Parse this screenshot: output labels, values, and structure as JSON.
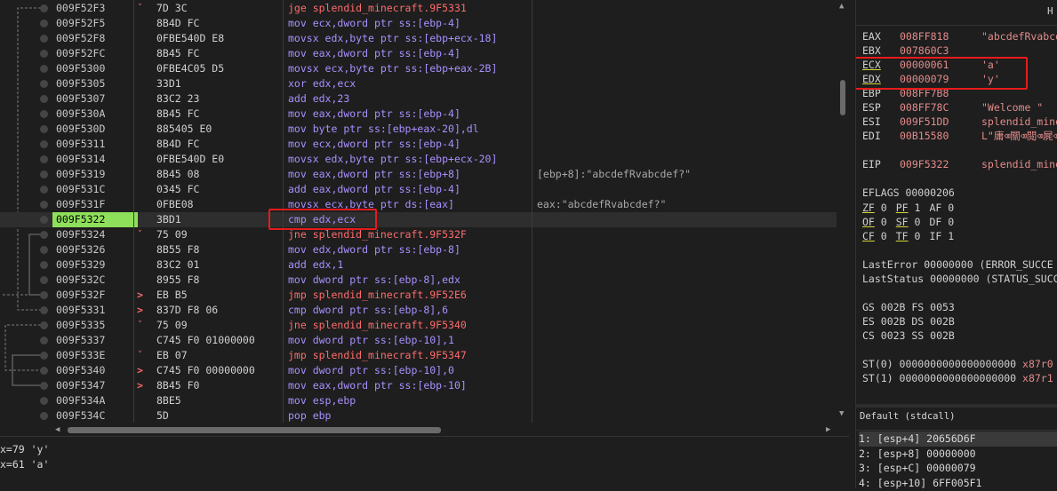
{
  "rows": [
    {
      "addr": "009F52F3",
      "mark": "ˇ",
      "bytes": "7D 3C",
      "op": "jge",
      "args": "splendid_minecraft.9F5331",
      "cls": "c-jmp",
      "cmt": ""
    },
    {
      "addr": "009F52F5",
      "mark": "",
      "bytes": "8B4D FC",
      "op": "mov",
      "args": "ecx,dword ptr ss:[ebp-4]",
      "cls": "c-mov",
      "cmt": ""
    },
    {
      "addr": "009F52F8",
      "mark": "",
      "bytes": "0FBE540D E8",
      "op": "movsx",
      "args": "edx,byte ptr ss:[ebp+ecx-18]",
      "cls": "c-mov",
      "cmt": ""
    },
    {
      "addr": "009F52FC",
      "mark": "",
      "bytes": "8B45 FC",
      "op": "mov",
      "args": "eax,dword ptr ss:[ebp-4]",
      "cls": "c-mov",
      "cmt": ""
    },
    {
      "addr": "009F5300",
      "mark": "",
      "bytes": "0FBE4C05 D5",
      "op": "movsx",
      "args": "ecx,byte ptr ss:[ebp+eax-2B]",
      "cls": "c-mov",
      "cmt": ""
    },
    {
      "addr": "009F5305",
      "mark": "",
      "bytes": "33D1",
      "op": "xor",
      "args": "edx,ecx",
      "cls": "c-xor",
      "cmt": ""
    },
    {
      "addr": "009F5307",
      "mark": "",
      "bytes": "83C2 23",
      "op": "add",
      "args": "edx,23",
      "cls": "c-arith",
      "cmt": ""
    },
    {
      "addr": "009F530A",
      "mark": "",
      "bytes": "8B45 FC",
      "op": "mov",
      "args": "eax,dword ptr ss:[ebp-4]",
      "cls": "c-mov",
      "cmt": ""
    },
    {
      "addr": "009F530D",
      "mark": "",
      "bytes": "885405 E0",
      "op": "mov",
      "args": "byte ptr ss:[ebp+eax-20],dl",
      "cls": "c-mov",
      "cmt": ""
    },
    {
      "addr": "009F5311",
      "mark": "",
      "bytes": "8B4D FC",
      "op": "mov",
      "args": "ecx,dword ptr ss:[ebp-4]",
      "cls": "c-mov",
      "cmt": ""
    },
    {
      "addr": "009F5314",
      "mark": "",
      "bytes": "0FBE540D E0",
      "op": "movsx",
      "args": "edx,byte ptr ss:[ebp+ecx-20]",
      "cls": "c-mov",
      "cmt": ""
    },
    {
      "addr": "009F5319",
      "mark": "",
      "bytes": "8B45 08",
      "op": "mov",
      "args": "eax,dword ptr ss:[ebp+8]",
      "cls": "c-mov",
      "cmt": "[ebp+8]:\"abcdefRvabcdef?\""
    },
    {
      "addr": "009F531C",
      "mark": "",
      "bytes": "0345 FC",
      "op": "add",
      "args": "eax,dword ptr ss:[ebp-4]",
      "cls": "c-arith",
      "cmt": ""
    },
    {
      "addr": "009F531F",
      "mark": "",
      "bytes": "0FBE08",
      "op": "movsx",
      "args": "ecx,byte ptr ds:[eax]",
      "cls": "c-mov",
      "cmt": "eax:\"abcdefRvabcdef?\""
    },
    {
      "addr": "009F5322",
      "mark": "",
      "bytes": "3BD1",
      "op": "cmp",
      "args": "edx,ecx",
      "cls": "c-cmp",
      "cmt": ""
    },
    {
      "addr": "009F5324",
      "mark": "ˇ",
      "bytes": "75 09",
      "op": "jne",
      "args": "splendid_minecraft.9F532F",
      "cls": "c-jcc",
      "cmt": ""
    },
    {
      "addr": "009F5326",
      "mark": "",
      "bytes": "8B55 F8",
      "op": "mov",
      "args": "edx,dword ptr ss:[ebp-8]",
      "cls": "c-mov",
      "cmt": ""
    },
    {
      "addr": "009F5329",
      "mark": "",
      "bytes": "83C2 01",
      "op": "add",
      "args": "edx,1",
      "cls": "c-arith",
      "cmt": ""
    },
    {
      "addr": "009F532C",
      "mark": "",
      "bytes": "8955 F8",
      "op": "mov",
      "args": "dword ptr ss:[ebp-8],edx",
      "cls": "c-mov",
      "cmt": ""
    },
    {
      "addr": "009F532F",
      "mark": ">",
      "bytes": "EB B5",
      "op": "jmp",
      "args": "splendid_minecraft.9F52E6",
      "cls": "c-jmp",
      "cmt": ""
    },
    {
      "addr": "009F5331",
      "mark": ">",
      "bytes": "837D F8 06",
      "op": "cmp",
      "args": "dword ptr ss:[ebp-8],6",
      "cls": "c-cmp",
      "cmt": ""
    },
    {
      "addr": "009F5335",
      "mark": "ˇ",
      "bytes": "75 09",
      "op": "jne",
      "args": "splendid_minecraft.9F5340",
      "cls": "c-jcc",
      "cmt": ""
    },
    {
      "addr": "009F5337",
      "mark": "",
      "bytes": "C745 F0 01000000",
      "op": "mov",
      "args": "dword ptr ss:[ebp-10],1",
      "cls": "c-mov",
      "cmt": ""
    },
    {
      "addr": "009F533E",
      "mark": "ˇ",
      "bytes": "EB 07",
      "op": "jmp",
      "args": "splendid_minecraft.9F5347",
      "cls": "c-jmp",
      "cmt": ""
    },
    {
      "addr": "009F5340",
      "mark": ">",
      "bytes": "C745 F0 00000000",
      "op": "mov",
      "args": "dword ptr ss:[ebp-10],0",
      "cls": "c-mov",
      "cmt": ""
    },
    {
      "addr": "009F5347",
      "mark": ">",
      "bytes": "8B45 F0",
      "op": "mov",
      "args": "eax,dword ptr ss:[ebp-10]",
      "cls": "c-mov",
      "cmt": ""
    },
    {
      "addr": "009F534A",
      "mark": "",
      "bytes": "8BE5",
      "op": "mov",
      "args": "esp,ebp",
      "cls": "c-mov",
      "cmt": ""
    },
    {
      "addr": "009F534C",
      "mark": "",
      "bytes": "5D",
      "op": "pop",
      "args": "ebp",
      "cls": "c-stack",
      "cmt": ""
    }
  ],
  "current_addr": "009F5322",
  "info_lines": [
    "x=79 'y'",
    "x=61 'a'"
  ],
  "regs_header": "H",
  "regs": [
    {
      "n": "EAX",
      "v": "008FF818",
      "c": "\"abcdefRvabcd"
    },
    {
      "n": "EBX",
      "v": "007860C3",
      "c": ""
    },
    {
      "n": "ECX",
      "v": "00000061",
      "c": "'a'"
    },
    {
      "n": "EDX",
      "v": "00000079",
      "c": "'y'"
    },
    {
      "n": "EBP",
      "v": "008FF7B8",
      "c": ""
    },
    {
      "n": "ESP",
      "v": "008FF78C",
      "c": "\"Welcome \""
    },
    {
      "n": "ESI",
      "v": "009F51DD",
      "c": "splendid_mine"
    },
    {
      "n": "EDI",
      "v": "00B15580",
      "c": "L\"庸⌫關⌫閲⌫屍⌫"
    }
  ],
  "eip": {
    "n": "EIP",
    "v": "009F5322",
    "c": "splendid_mine"
  },
  "eflags": {
    "n": "EFLAGS",
    "v": "00000206"
  },
  "flags": [
    [
      {
        "n": "ZF",
        "v": "0"
      },
      {
        "n": "PF",
        "v": "1"
      },
      {
        "n": "AF",
        "v": "0"
      }
    ],
    [
      {
        "n": "OF",
        "v": "0"
      },
      {
        "n": "SF",
        "v": "0"
      },
      {
        "n": "DF",
        "v": "0"
      }
    ],
    [
      {
        "n": "CF",
        "v": "0"
      },
      {
        "n": "TF",
        "v": "0"
      },
      {
        "n": "IF",
        "v": "1"
      }
    ]
  ],
  "last_error": {
    "n": "LastError",
    "v": "00000000 (ERROR_SUCCE"
  },
  "last_status": {
    "n": "LastStatus",
    "v": "00000000 (STATUS_SUCC"
  },
  "segs": [
    [
      {
        "n": "GS",
        "v": "002B"
      },
      {
        "n": "FS",
        "v": "0053"
      }
    ],
    [
      {
        "n": "ES",
        "v": "002B"
      },
      {
        "n": "DS",
        "v": "002B"
      }
    ],
    [
      {
        "n": "CS",
        "v": "0023"
      },
      {
        "n": "SS",
        "v": "002B"
      }
    ]
  ],
  "fpu": [
    {
      "n": "ST(0)",
      "v": "0000000000000000000",
      "c": "x87r0"
    },
    {
      "n": "ST(1)",
      "v": "0000000000000000000",
      "c": "x87r1"
    }
  ],
  "call_convention": "Default (stdcall)",
  "stack": [
    {
      "t": "1: [esp+4] 20656D6F",
      "sel": true
    },
    {
      "t": "2: [esp+8] 00000000",
      "sel": false
    },
    {
      "t": "3: [esp+C] 00000079",
      "sel": false
    },
    {
      "t": "4: [esp+10] 6FF005F1",
      "sel": false
    }
  ],
  "colors": {
    "highlight_box": "#e81b1b",
    "current_addr_bg": "#8ee05a",
    "reg_changed": "#e38b8b"
  }
}
